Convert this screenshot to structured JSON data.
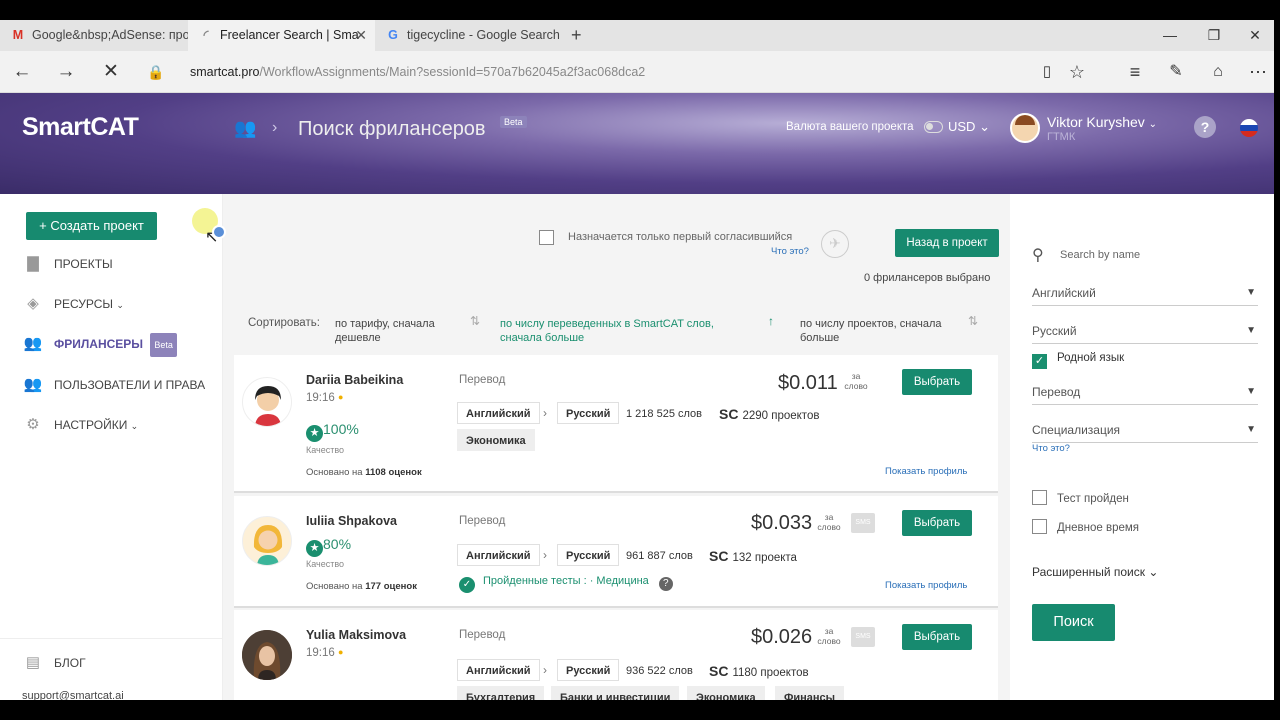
{
  "browser": {
    "tabs": [
      {
        "label": "Google&nbsp;AdSense: про",
        "icon": "gmail-icon"
      },
      {
        "label": "Freelancer Search | Sma",
        "icon": "loading-icon"
      },
      {
        "label": "tigecycline - Google Search",
        "icon": "google-icon"
      }
    ],
    "url_host": "smartcat.pro",
    "url_path": "/WorkflowAssignments/Main?sessionId=570a7b62045a2f3ac068dca2"
  },
  "header": {
    "logo": "SmartCAT",
    "title": "Поиск фрилансеров",
    "beta": "Beta",
    "currency_label": "Валюта вашего проекта",
    "currency": "USD",
    "user_name": "Viktor Kuryshev",
    "user_org": "ГТМК"
  },
  "sidebar": {
    "create_button": "+ Создать проект",
    "items": [
      {
        "label": "ПРОЕКТЫ"
      },
      {
        "label": "РЕСУРСЫ"
      },
      {
        "label": "ФРИЛАНСЕРЫ",
        "badge": "Beta"
      },
      {
        "label": "ПОЛЬЗОВАТЕЛИ И ПРАВА"
      },
      {
        "label": "НАСТРОЙКИ"
      }
    ],
    "blog": "БЛОГ",
    "support": "support@smartcat.ai"
  },
  "main": {
    "assign_first": "Назначается только первый согласившийся",
    "whats_this": "Что это?",
    "back_button": "Назад в проект",
    "selected_count": "0 фрилансеров выбрано",
    "sort_label": "Сортировать:",
    "sort_options": [
      {
        "line1": "по тарифу, сначала",
        "line2": "дешевле"
      },
      {
        "line1": "по числу переведенных в SmartCAT слов,",
        "line2": "сначала больше"
      },
      {
        "line1": "по числу проектов, сначала",
        "line2": "больше"
      }
    ],
    "freelancers": [
      {
        "name": "Dariia Babeikina",
        "time": "19:16",
        "quality": "100%",
        "quality_label": "Качество",
        "based_prefix": "Основано на",
        "based_count": "1108 оценок",
        "service": "Перевод",
        "source": "Английский",
        "target": "Русский",
        "words": "1 218 525 слов",
        "sc_label": "SC",
        "projects": "2290 проектов",
        "price": "$0.011",
        "per_word": "за слово",
        "select": "Выбрать",
        "tags": [
          "Экономика"
        ],
        "profile": "Показать профиль"
      },
      {
        "name": "Iuliia Shpakova",
        "quality": "80%",
        "quality_label": "Качество",
        "based_prefix": "Основано на",
        "based_count": "177 оценок",
        "service": "Перевод",
        "source": "Английский",
        "target": "Русский",
        "words": "961 887 слов",
        "sc_label": "SC",
        "projects": "132 проекта",
        "price": "$0.033",
        "per_word": "за слово",
        "sms": "SMS",
        "select": "Выбрать",
        "tests_label": "Пройденные тесты :",
        "tests_value": "· Медицина",
        "profile": "Показать профиль"
      },
      {
        "name": "Yulia Maksimova",
        "time": "19:16",
        "service": "Перевод",
        "source": "Английский",
        "target": "Русский",
        "words": "936 522 слов",
        "sc_label": "SC",
        "projects": "1180 проектов",
        "price": "$0.026",
        "per_word": "за слово",
        "sms": "SMS",
        "select": "Выбрать",
        "tags": [
          "Бухгалтерия",
          "Банки и инвестиции",
          "Экономика",
          "Финансы"
        ]
      }
    ]
  },
  "filters": {
    "search_placeholder": "Search by name",
    "source_lang": "Английский",
    "target_lang": "Русский",
    "native": "Родной язык",
    "service": "Перевод",
    "specialization": "Специализация",
    "whats_this": "Что это?",
    "test_passed": "Тест пройден",
    "daytime": "Дневное время",
    "advanced": "Расширенный поиск",
    "search_button": "Поиск"
  },
  "colors": {
    "accent": "#178a6f",
    "brand": "#5a4fa0",
    "link": "#2a6fb8"
  }
}
